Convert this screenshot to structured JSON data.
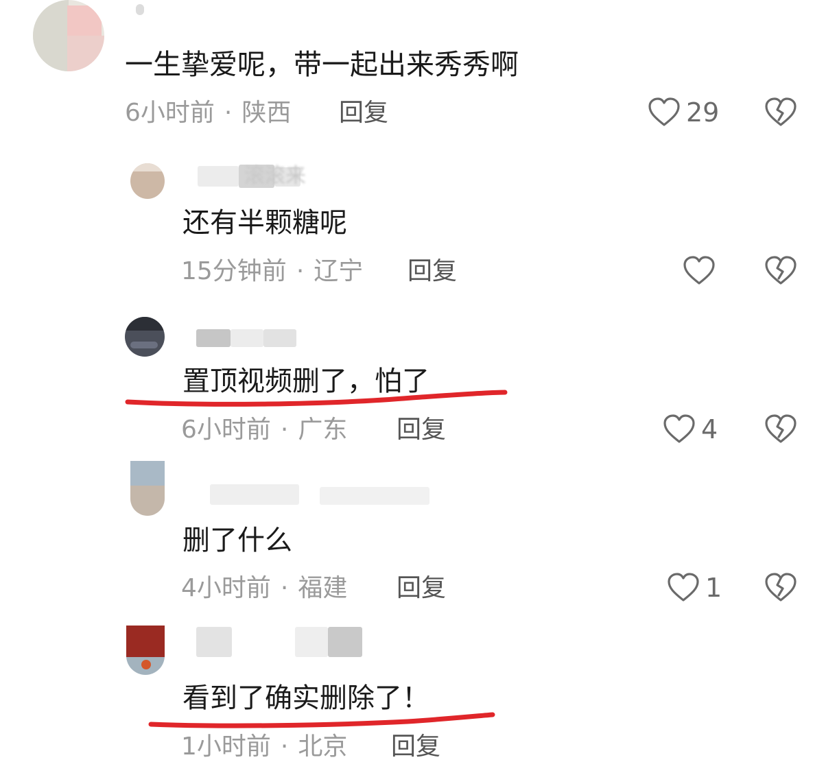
{
  "comments": [
    {
      "username": "",
      "text": "一生挚爱呢，带一起出来秀秀啊",
      "time": "6小时前",
      "location": "陕西",
      "reply_label": "回复",
      "likes": "29"
    },
    {
      "username": "滚滚来",
      "text": "还有半颗糖呢",
      "time": "15分钟前",
      "location": "辽宁",
      "reply_label": "回复",
      "likes": ""
    },
    {
      "username": "",
      "text": "置顶视频删了，怕了",
      "time": "6小时前",
      "location": "广东",
      "reply_label": "回复",
      "likes": "4"
    },
    {
      "username": "",
      "text": "删了什么",
      "time": "4小时前",
      "location": "福建",
      "reply_label": "回复",
      "likes": "1"
    },
    {
      "username": "",
      "text": "看到了确实删除了！",
      "time": "1小时前",
      "location": "北京",
      "reply_label": "回复",
      "likes": ""
    }
  ],
  "separator": "·",
  "colors": {
    "text": "#1a1a1a",
    "meta": "#9a9a9a",
    "underline": "#e0262a",
    "icon": "#6a6a6a"
  },
  "icons": [
    "heart-outline-icon",
    "broken-heart-icon"
  ]
}
